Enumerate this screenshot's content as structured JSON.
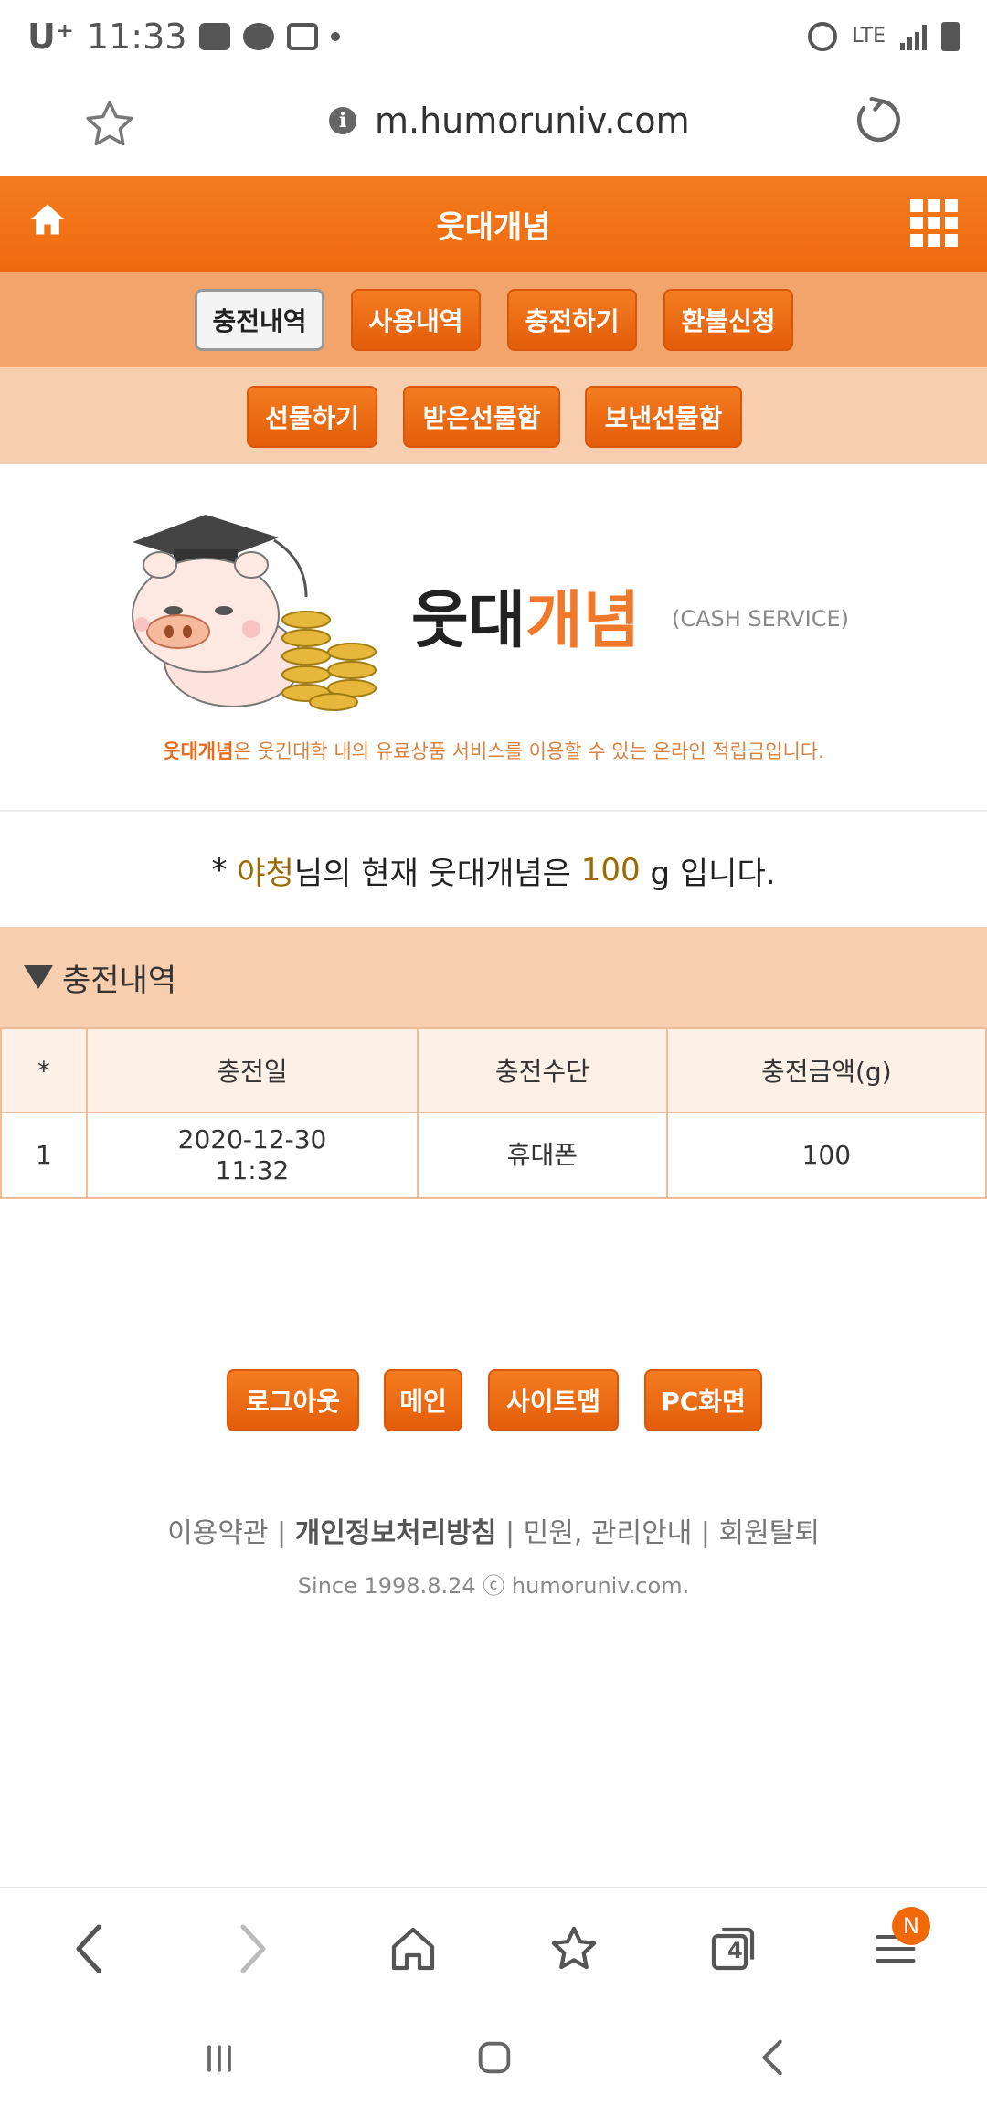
{
  "status_bar": {
    "carrier": "U⁺",
    "time": "11:33",
    "network": "LTE"
  },
  "browser": {
    "url": "m.humoruniv.com",
    "tab_count": "4",
    "notification_badge": "N"
  },
  "header": {
    "title": "웃대개념"
  },
  "tabs_row1": [
    {
      "label": "충전내역",
      "active": true
    },
    {
      "label": "사용내역",
      "active": false
    },
    {
      "label": "충전하기",
      "active": false
    },
    {
      "label": "환불신청",
      "active": false
    }
  ],
  "tabs_row2": [
    {
      "label": "선물하기"
    },
    {
      "label": "받은선물함"
    },
    {
      "label": "보낸선물함"
    }
  ],
  "banner": {
    "brand_main": "웃대",
    "brand_accent": "개념",
    "cash_label": "(CASH SERVICE)",
    "desc_bold": "웃대개념",
    "desc_rest": "은 웃긴대학 내의 유료상품 서비스를 이용할 수 있는 온라인 적립금입니다."
  },
  "balance": {
    "prefix": "* ",
    "user": "야청",
    "mid": "님의 현재 웃대개념은 ",
    "amount": "100",
    "suffix": " g 입니다."
  },
  "section": {
    "title": "충전내역"
  },
  "table": {
    "headers": [
      "*",
      "충전일",
      "충전수단",
      "충전금액(g)"
    ],
    "rows": [
      {
        "no": "1",
        "date": "2020-12-30",
        "time": "11:32",
        "method": "휴대폰",
        "amount": "100"
      }
    ]
  },
  "footer_buttons": [
    "로그아웃",
    "메인",
    "사이트맵",
    "PC화면"
  ],
  "footer_links": {
    "terms": "이용약관",
    "privacy": "개인정보처리방침",
    "complaints": "민원, 관리안내",
    "withdraw": "회원탈퇴",
    "sep": " | "
  },
  "since": "Since 1998.8.24 ⓒ humoruniv.com.",
  "colors": {
    "brand_orange": "#f47c20",
    "tab_bg": "#f3a46a",
    "light_peach": "#f8cfae",
    "gold_text": "#9c6a00"
  }
}
